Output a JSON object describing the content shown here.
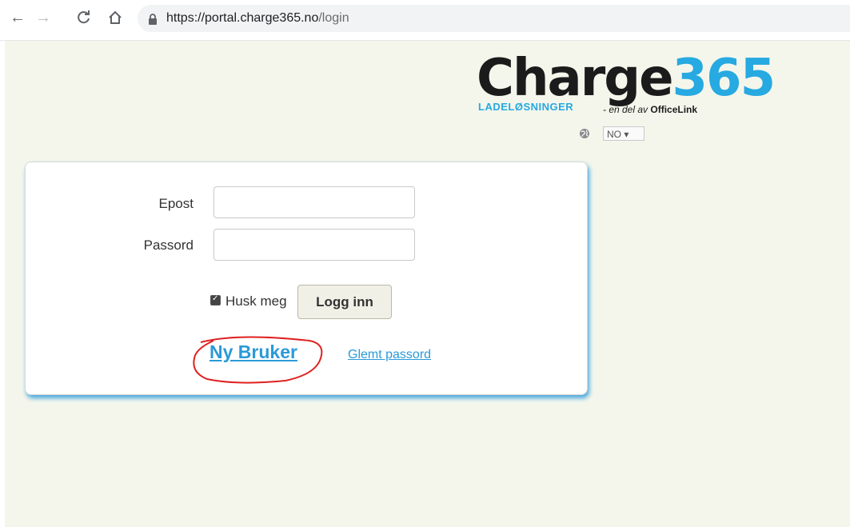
{
  "browser": {
    "url_host": "https://portal.charge365.no",
    "url_path": "/login",
    "back_icon": "arrow-left-icon",
    "forward_icon": "arrow-right-icon",
    "reload_icon": "reload-icon",
    "home_icon": "home-icon",
    "lock_icon": "lock-icon"
  },
  "logo": {
    "word_part1": "Charge",
    "word_part2": "365",
    "subtitle": "LADELØSNINGER",
    "tagline_prefix": "- en del av ",
    "tagline_brand": "OfficeLink",
    "colors": {
      "dark": "#1b1b1b",
      "accent": "#27a9e1"
    }
  },
  "language": {
    "icon": "globe-icon",
    "selected": "NO ▾"
  },
  "login_form": {
    "email_label": "Epost",
    "email_value": "",
    "password_label": "Passord",
    "password_value": "",
    "remember_label": "Husk meg",
    "remember_checked": true,
    "login_button": "Logg inn",
    "new_user_link": "Ny Bruker ",
    "forgot_password_link": "Glemt passord"
  },
  "annotation": {
    "color": "#e02020"
  }
}
